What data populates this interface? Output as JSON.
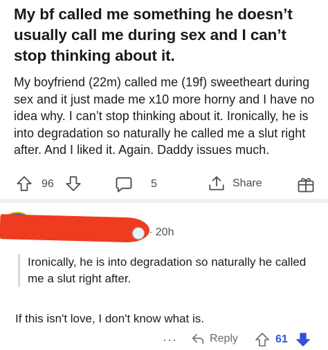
{
  "post": {
    "title": "My bf called me something he doesn’t usually call me during sex and I can’t stop thinking about it.",
    "body": "My boyfriend (22m) called me (19f) sweetheart during sex and it just made me x10 more horny and I have no idea why. I can’t stop thinking about it.  Ironically, he is into degradation so naturally he called me a slut right after. And I liked it. Again. Daddy issues much.",
    "vote_count": "96",
    "comment_count": "5",
    "share_label": "Share"
  },
  "comment": {
    "time": "· 20h",
    "quote": "Ironically, he is into degradation so naturally he called me a slut right after.",
    "text": "If this isn't love, I don't know what is.",
    "more_label": "···",
    "reply_label": "Reply",
    "vote_count": "61"
  },
  "colors": {
    "upvoted_blue": "#2f54d6",
    "redaction_red": "#ef3b1f",
    "icon_gray": "#4a4a4a"
  },
  "icons": {
    "upvote": "arrow-up-outline-icon",
    "downvote": "arrow-down-outline-icon",
    "comment": "speech-bubble-icon",
    "share": "share-upload-icon",
    "award": "gift-box-icon",
    "reply": "reply-arrow-icon",
    "downvote_filled": "arrow-down-filled-icon"
  }
}
